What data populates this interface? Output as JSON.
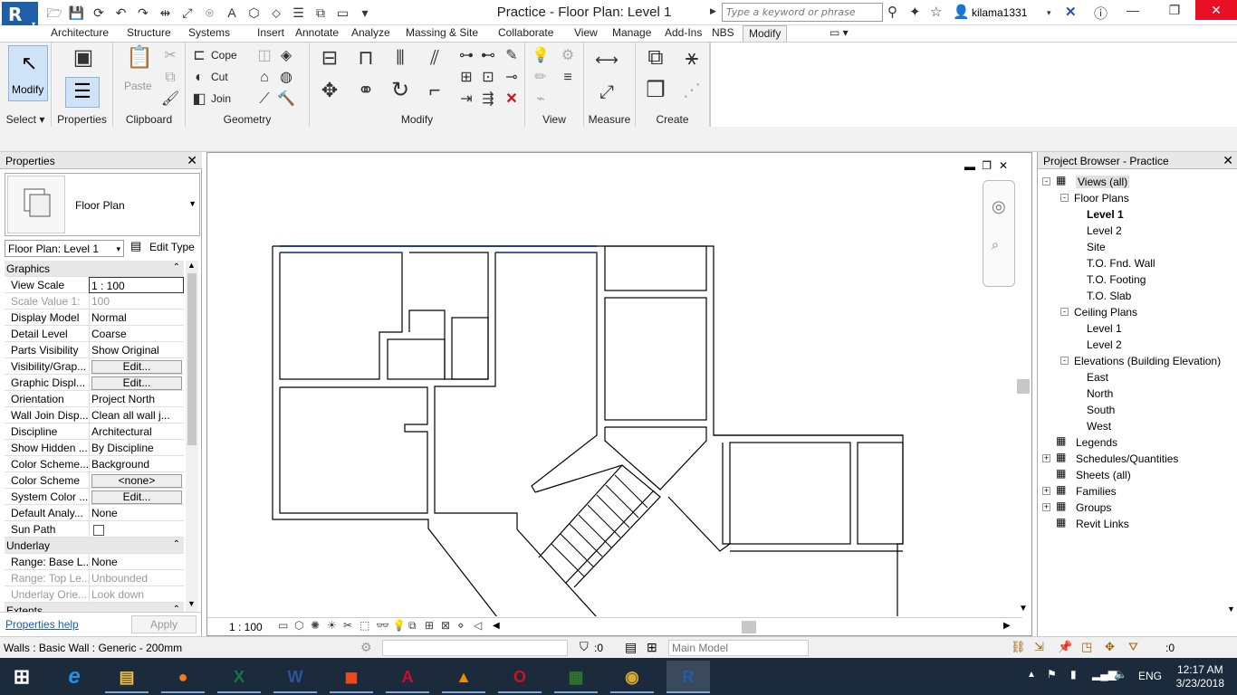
{
  "app": {
    "title": "Practice - Floor Plan: Level 1",
    "logo": "R"
  },
  "quick_access": [
    "open-icon",
    "save-icon",
    "sync-icon",
    "undo-icon",
    "redo-icon",
    "measure-icon",
    "dimension-icon",
    "tag-icon",
    "text-icon",
    "3d-view-icon",
    "section-icon",
    "thin-lines-icon",
    "close-views-icon",
    "switch-windows-icon",
    "customize-icon"
  ],
  "search": {
    "placeholder": "Type a keyword or phrase"
  },
  "user": {
    "name": "kilama1331"
  },
  "tabs": [
    "Architecture",
    "Structure",
    "Systems",
    "Insert",
    "Annotate",
    "Analyze",
    "Massing & Site",
    "Collaborate",
    "View",
    "Manage",
    "Add-Ins",
    "NBS",
    "Modify"
  ],
  "active_tab": "Modify",
  "ribbon": {
    "select": {
      "button": "Modify",
      "label": "Select ▾"
    },
    "properties": {
      "label": "Properties"
    },
    "clipboard": {
      "paste": "Paste",
      "label": "Clipboard"
    },
    "geometry": {
      "cope": "Cope",
      "cut": "Cut",
      "join": "Join",
      "label": "Geometry"
    },
    "modify": {
      "label": "Modify"
    },
    "view": {
      "label": "View"
    },
    "measure": {
      "label": "Measure"
    },
    "create": {
      "label": "Create"
    }
  },
  "properties_panel": {
    "title": "Properties",
    "type_name": "Floor Plan",
    "view_selector": "Floor Plan: Level 1",
    "edit_type": "Edit Type",
    "rows": [
      {
        "k": "Graphics",
        "group": true
      },
      {
        "k": "View Scale",
        "v": "1 : 100",
        "input": true
      },
      {
        "k": "Scale Value    1:",
        "v": "100",
        "dim": true
      },
      {
        "k": "Display Model",
        "v": "Normal"
      },
      {
        "k": "Detail Level",
        "v": "Coarse"
      },
      {
        "k": "Parts Visibility",
        "v": "Show Original"
      },
      {
        "k": "Visibility/Grap...",
        "v": "Edit...",
        "btn": true
      },
      {
        "k": "Graphic Displ...",
        "v": "Edit...",
        "btn": true
      },
      {
        "k": "Orientation",
        "v": "Project North"
      },
      {
        "k": "Wall Join Disp...",
        "v": "Clean all wall j..."
      },
      {
        "k": "Discipline",
        "v": "Architectural"
      },
      {
        "k": "Show Hidden ...",
        "v": "By Discipline"
      },
      {
        "k": "Color Scheme...",
        "v": "Background"
      },
      {
        "k": "Color Scheme",
        "v": "<none>",
        "btn": true
      },
      {
        "k": "System Color ...",
        "v": "Edit...",
        "btn": true
      },
      {
        "k": "Default Analy...",
        "v": "None"
      },
      {
        "k": "Sun Path",
        "v": "",
        "check": true
      },
      {
        "k": "Underlay",
        "group": true
      },
      {
        "k": "Range: Base L...",
        "v": "None"
      },
      {
        "k": "Range: Top Le...",
        "v": "Unbounded",
        "dim": true
      },
      {
        "k": "Underlay Orie...",
        "v": "Look down",
        "dim": true
      },
      {
        "k": "Extents",
        "group": true
      }
    ],
    "help": "Properties help",
    "apply": "Apply"
  },
  "view_control": {
    "scale": "1 : 100"
  },
  "browser": {
    "title": "Project Browser - Practice",
    "items": [
      {
        "t": "Views (all)",
        "lvl": 0,
        "exp": "-",
        "ic": true,
        "sel": true
      },
      {
        "t": "Floor Plans",
        "lvl": 1,
        "exp": "-"
      },
      {
        "t": "Level 1",
        "lvl": 2,
        "bold": true
      },
      {
        "t": "Level 2",
        "lvl": 2
      },
      {
        "t": "Site",
        "lvl": 2
      },
      {
        "t": "T.O. Fnd. Wall",
        "lvl": 2
      },
      {
        "t": "T.O. Footing",
        "lvl": 2
      },
      {
        "t": "T.O. Slab",
        "lvl": 2
      },
      {
        "t": "Ceiling Plans",
        "lvl": 1,
        "exp": "-"
      },
      {
        "t": "Level 1",
        "lvl": 2
      },
      {
        "t": "Level 2",
        "lvl": 2
      },
      {
        "t": "Elevations (Building Elevation)",
        "lvl": 1,
        "exp": "-"
      },
      {
        "t": "East",
        "lvl": 2
      },
      {
        "t": "North",
        "lvl": 2
      },
      {
        "t": "South",
        "lvl": 2
      },
      {
        "t": "West",
        "lvl": 2
      },
      {
        "t": "Legends",
        "lvl": 0,
        "ic": true
      },
      {
        "t": "Schedules/Quantities",
        "lvl": 0,
        "exp": "+",
        "ic": true
      },
      {
        "t": "Sheets (all)",
        "lvl": 0,
        "ic": true
      },
      {
        "t": "Families",
        "lvl": 0,
        "exp": "+",
        "ic": true
      },
      {
        "t": "Groups",
        "lvl": 0,
        "exp": "+",
        "ic": true
      },
      {
        "t": "Revit Links",
        "lvl": 0,
        "ic": true
      }
    ]
  },
  "status": {
    "text": "Walls : Basic Wall : Generic - 200mm",
    "sel_count": ":0",
    "model": "Main Model",
    "filter_count": ":0"
  },
  "taskbar": {
    "apps": [
      {
        "name": "file-explorer",
        "g": "▤",
        "c": "#f0c040"
      },
      {
        "name": "firefox",
        "g": "●",
        "c": "#ff7a1a"
      },
      {
        "name": "excel",
        "g": "X",
        "c": "#1e7145"
      },
      {
        "name": "word",
        "g": "W",
        "c": "#2b579a"
      },
      {
        "name": "office",
        "g": "◼",
        "c": "#e84a1c"
      },
      {
        "name": "autocad",
        "g": "A",
        "c": "#c8102e"
      },
      {
        "name": "vlc",
        "g": "▲",
        "c": "#f08a00"
      },
      {
        "name": "opera",
        "g": "O",
        "c": "#d01020"
      },
      {
        "name": "project",
        "g": "▦",
        "c": "#31752f"
      },
      {
        "name": "chrome",
        "g": "◉",
        "c": "#dba832"
      },
      {
        "name": "revit",
        "g": "R",
        "c": "#1f5fa8"
      }
    ],
    "lang": "ENG",
    "time": "12:17 AM",
    "date": "3/23/2018"
  }
}
